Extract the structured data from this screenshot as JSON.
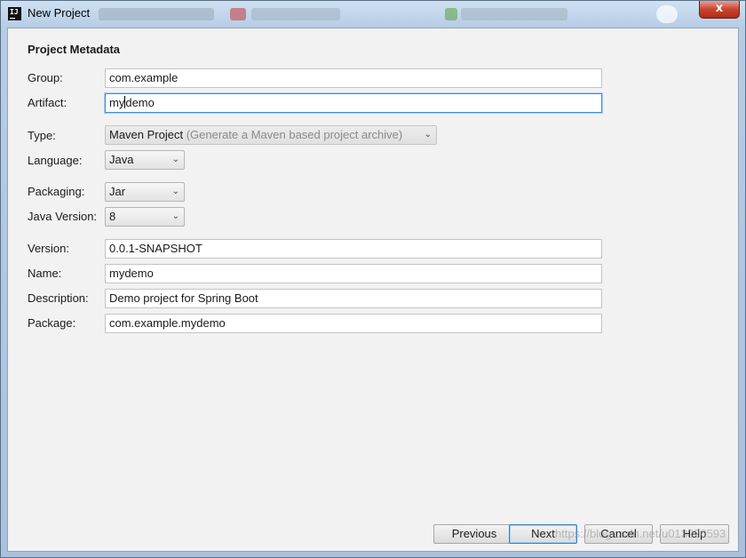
{
  "window": {
    "title": "New Project",
    "close_glyph": "x"
  },
  "section": {
    "title": "Project Metadata"
  },
  "form": {
    "group": {
      "label": "Group:",
      "value": "com.example"
    },
    "artifact": {
      "label": "Artifact:",
      "value_before_caret": "my",
      "value_after_caret": "demo"
    },
    "type": {
      "label": "Type:",
      "value": "Maven Project",
      "hint": "(Generate a Maven based project archive)"
    },
    "language": {
      "label": "Language:",
      "value": "Java"
    },
    "packaging": {
      "label": "Packaging:",
      "value": "Jar"
    },
    "java_version": {
      "label": "Java Version:",
      "value": "8"
    },
    "version": {
      "label": "Version:",
      "value": "0.0.1-SNAPSHOT"
    },
    "name": {
      "label": "Name:",
      "value": "mydemo"
    },
    "description": {
      "label": "Description:",
      "value": "Demo project for Spring Boot"
    },
    "package": {
      "label": "Package:",
      "value": "com.example.mydemo"
    }
  },
  "buttons": {
    "previous": "Previous",
    "next": "Next",
    "cancel": "Cancel",
    "help": "Help"
  },
  "watermark": "https://blog.csdn.net/u013020593",
  "icons": {
    "app": "intellij-idea-icon",
    "dropdown": "chevron-down-icon",
    "close": "close-icon"
  }
}
